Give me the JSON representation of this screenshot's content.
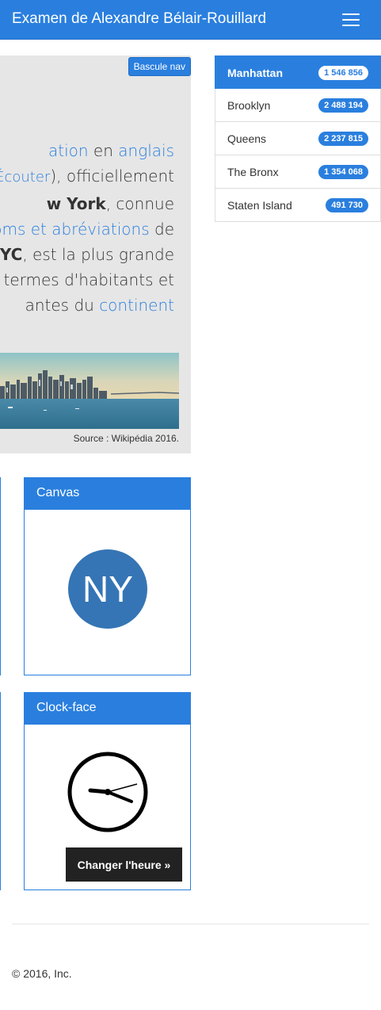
{
  "navbar": {
    "brand": "Examen de Alexandre Bélair-Rouillard",
    "menu_icon": "hamburger-menu-icon"
  },
  "jumbotron": {
    "toggle_label": "Bascule nav",
    "lines": [
      {
        "parts": [
          {
            "t": "ation",
            "k": "a"
          },
          {
            "t": " en ",
            "k": "t"
          },
          {
            "t": "anglais",
            "k": "a"
          }
        ]
      },
      {
        "parts": [
          {
            "t": "🔈",
            "k": "s"
          },
          {
            "t": " Écouter",
            "k": "l"
          },
          {
            "t": "), officiellement",
            "k": "t"
          }
        ]
      },
      {
        "parts": [
          {
            "t": "w York",
            "k": "b"
          },
          {
            "t": ", connue",
            "k": "t"
          }
        ]
      },
      {
        "parts": [
          {
            "t": "oms et abréviations",
            "k": "a"
          },
          {
            "t": " de",
            "k": "t"
          }
        ]
      },
      {
        "parts": [
          {
            "t": "YC",
            "k": "b"
          },
          {
            "t": ", est la plus grande",
            "k": "t"
          }
        ]
      },
      {
        "parts": [
          {
            "t": "n termes d'habitants et",
            "k": "t"
          }
        ]
      },
      {
        "parts": [
          {
            "t": "antes du ",
            "k": "t"
          },
          {
            "t": "continent",
            "k": "a"
          }
        ]
      }
    ],
    "image_caption": "Source : Wikipédia 2016."
  },
  "boroughs": [
    {
      "name": "Manhattan",
      "population": "1 546 856",
      "active": true
    },
    {
      "name": "Brooklyn",
      "population": "2 488 194",
      "active": false
    },
    {
      "name": "Queens",
      "population": "2 237 815",
      "active": false
    },
    {
      "name": "The Bronx",
      "population": "1 354 068",
      "active": false
    },
    {
      "name": "Staten Island",
      "population": "491 730",
      "active": false
    }
  ],
  "canvas_panel": {
    "title": "Canvas",
    "circle_text": "NY",
    "circle_color": "#3575b5"
  },
  "clock_panel": {
    "title": "Clock-face",
    "button_label": "Changer l'heure »"
  },
  "footer": {
    "copyright": "© 2016, Inc."
  },
  "colors": {
    "primary": "#2a7fde",
    "dark_button": "#222222",
    "jumbotron_bg": "#e6e6e6"
  }
}
